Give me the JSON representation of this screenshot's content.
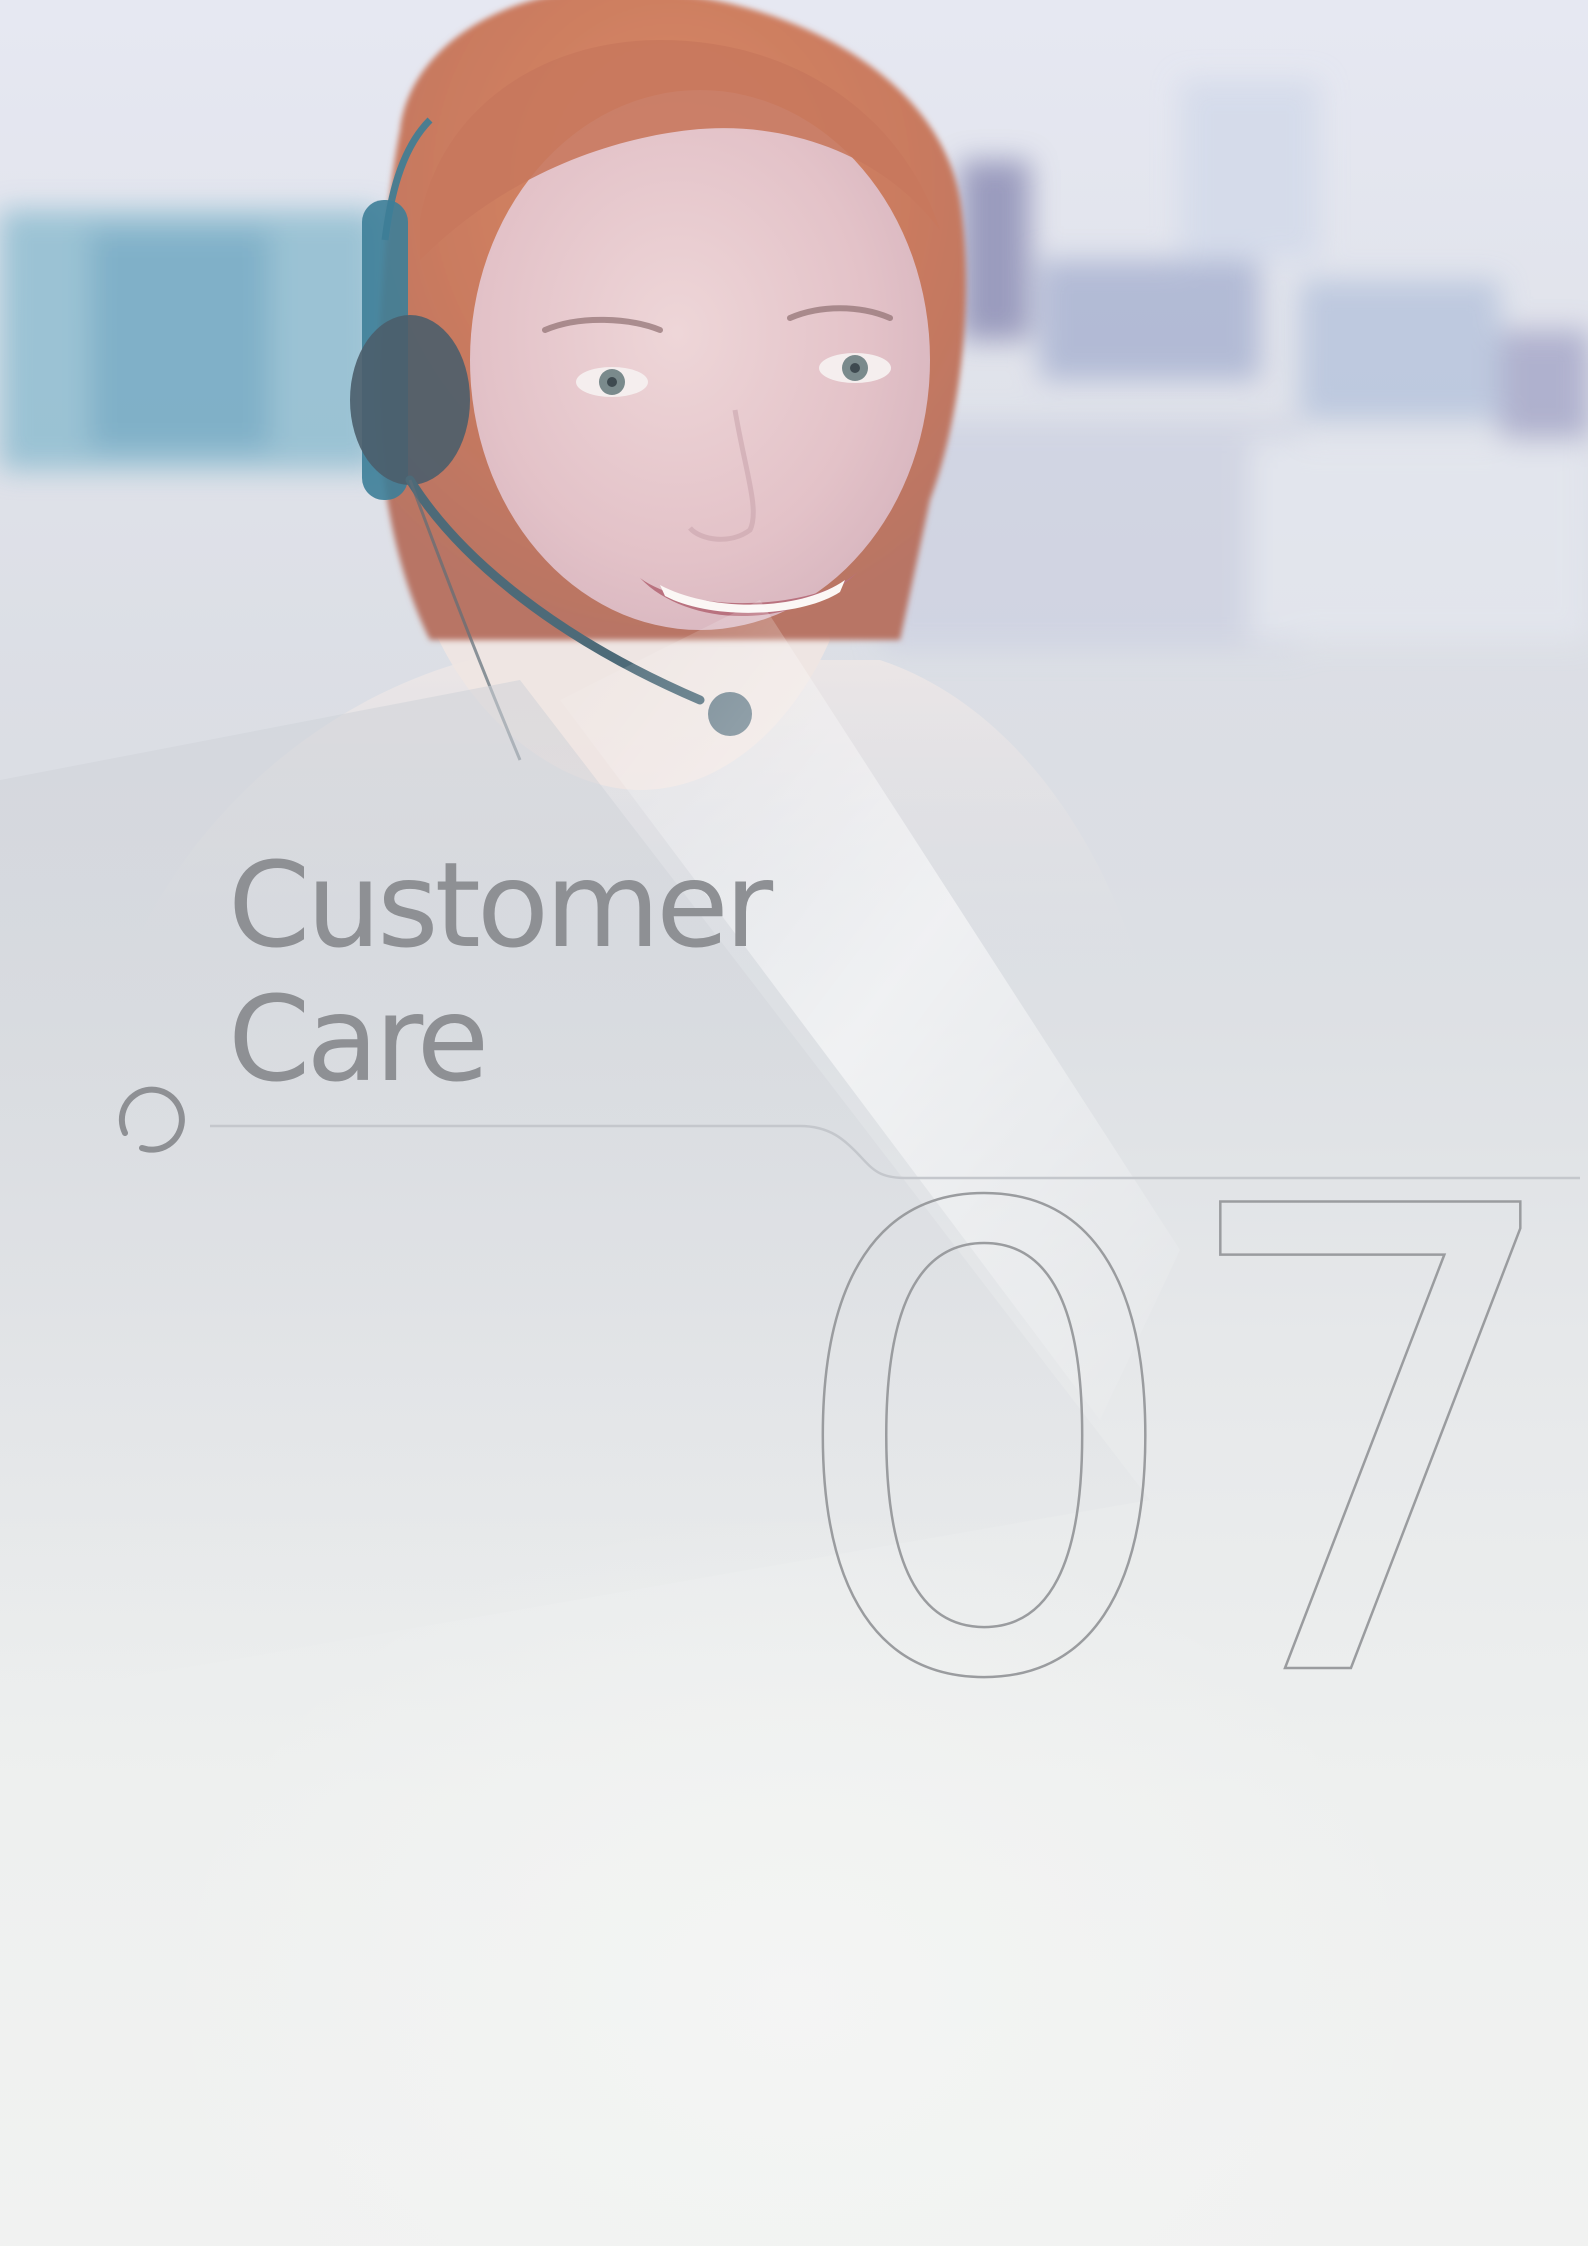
{
  "title": {
    "line1": "Customer",
    "line2": "Care"
  },
  "section_number": "07",
  "photo": {
    "subject": "smiling customer service agent wearing a headset"
  },
  "colors": {
    "title_text": "#8e9094",
    "outline": "#9a9c9f",
    "divider": "#c4c7cc",
    "headset": "#3d7e98"
  },
  "icons": {
    "section_marker": "open-circle-icon"
  }
}
